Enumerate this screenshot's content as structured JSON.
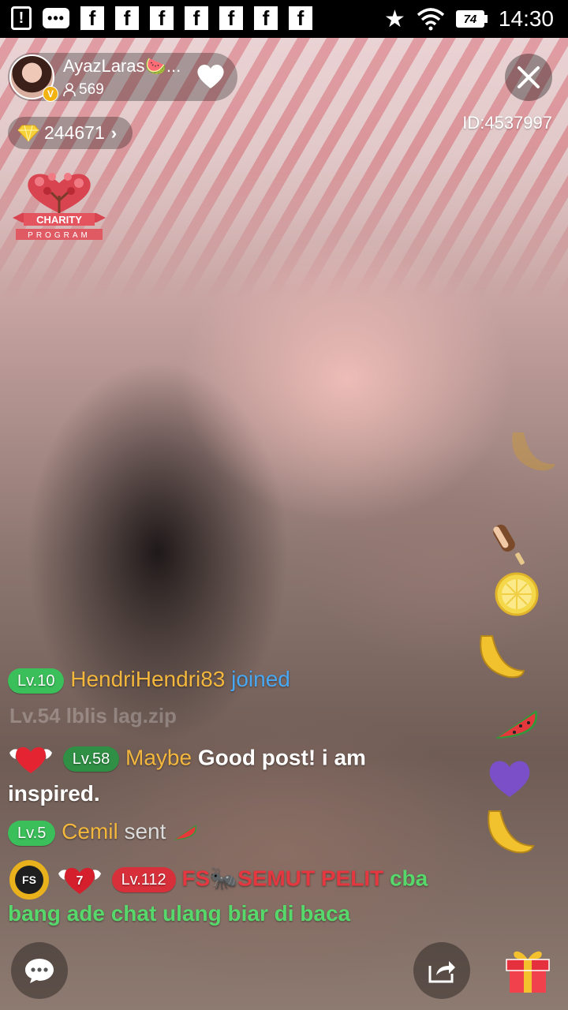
{
  "status_bar": {
    "alert_glyph": "!",
    "messages_glyph": "•••",
    "app_glyph": "f",
    "app_icon_count": 7,
    "battery": "74",
    "time": "14:30"
  },
  "host": {
    "name": "AyazLaras🍉...",
    "viewers": "569",
    "verified_badge": "V"
  },
  "room": {
    "id_label": "ID:4537997",
    "diamonds": "244671"
  },
  "charity": {
    "line1": "CHARITY",
    "line2": "PROGRAM"
  },
  "chat": {
    "join": {
      "level": "Lv.10",
      "user": "HendriHendri83",
      "action": "joined"
    },
    "faded": {
      "level": "Lv.54",
      "text": "lblis lag.zip"
    },
    "msg1": {
      "level": "Lv.58",
      "user": "Maybe",
      "line1": "Good post! i am",
      "line2": "inspired."
    },
    "gift": {
      "level": "Lv.5",
      "user": "Cemil",
      "action": "sent"
    },
    "msg2": {
      "badge_fs": "FS",
      "badge_heart_number": "7",
      "level": "Lv.112",
      "user": "FS🐜SEMUT PELIT",
      "line1": "cba",
      "line2": "bang ade chat ulang biar di baca"
    }
  },
  "colors": {
    "level_green": "#3bbf5a",
    "level_dark_green": "#2f8f44",
    "level_red": "#d8303a",
    "username_gold": "#f4b73d",
    "joined_blue": "#49a8f4"
  },
  "floating_icons": [
    "banana-icon",
    "popsicle-icon",
    "lemon-icon",
    "banana-icon",
    "watermelon-icon",
    "heart-icon",
    "banana-icon"
  ]
}
